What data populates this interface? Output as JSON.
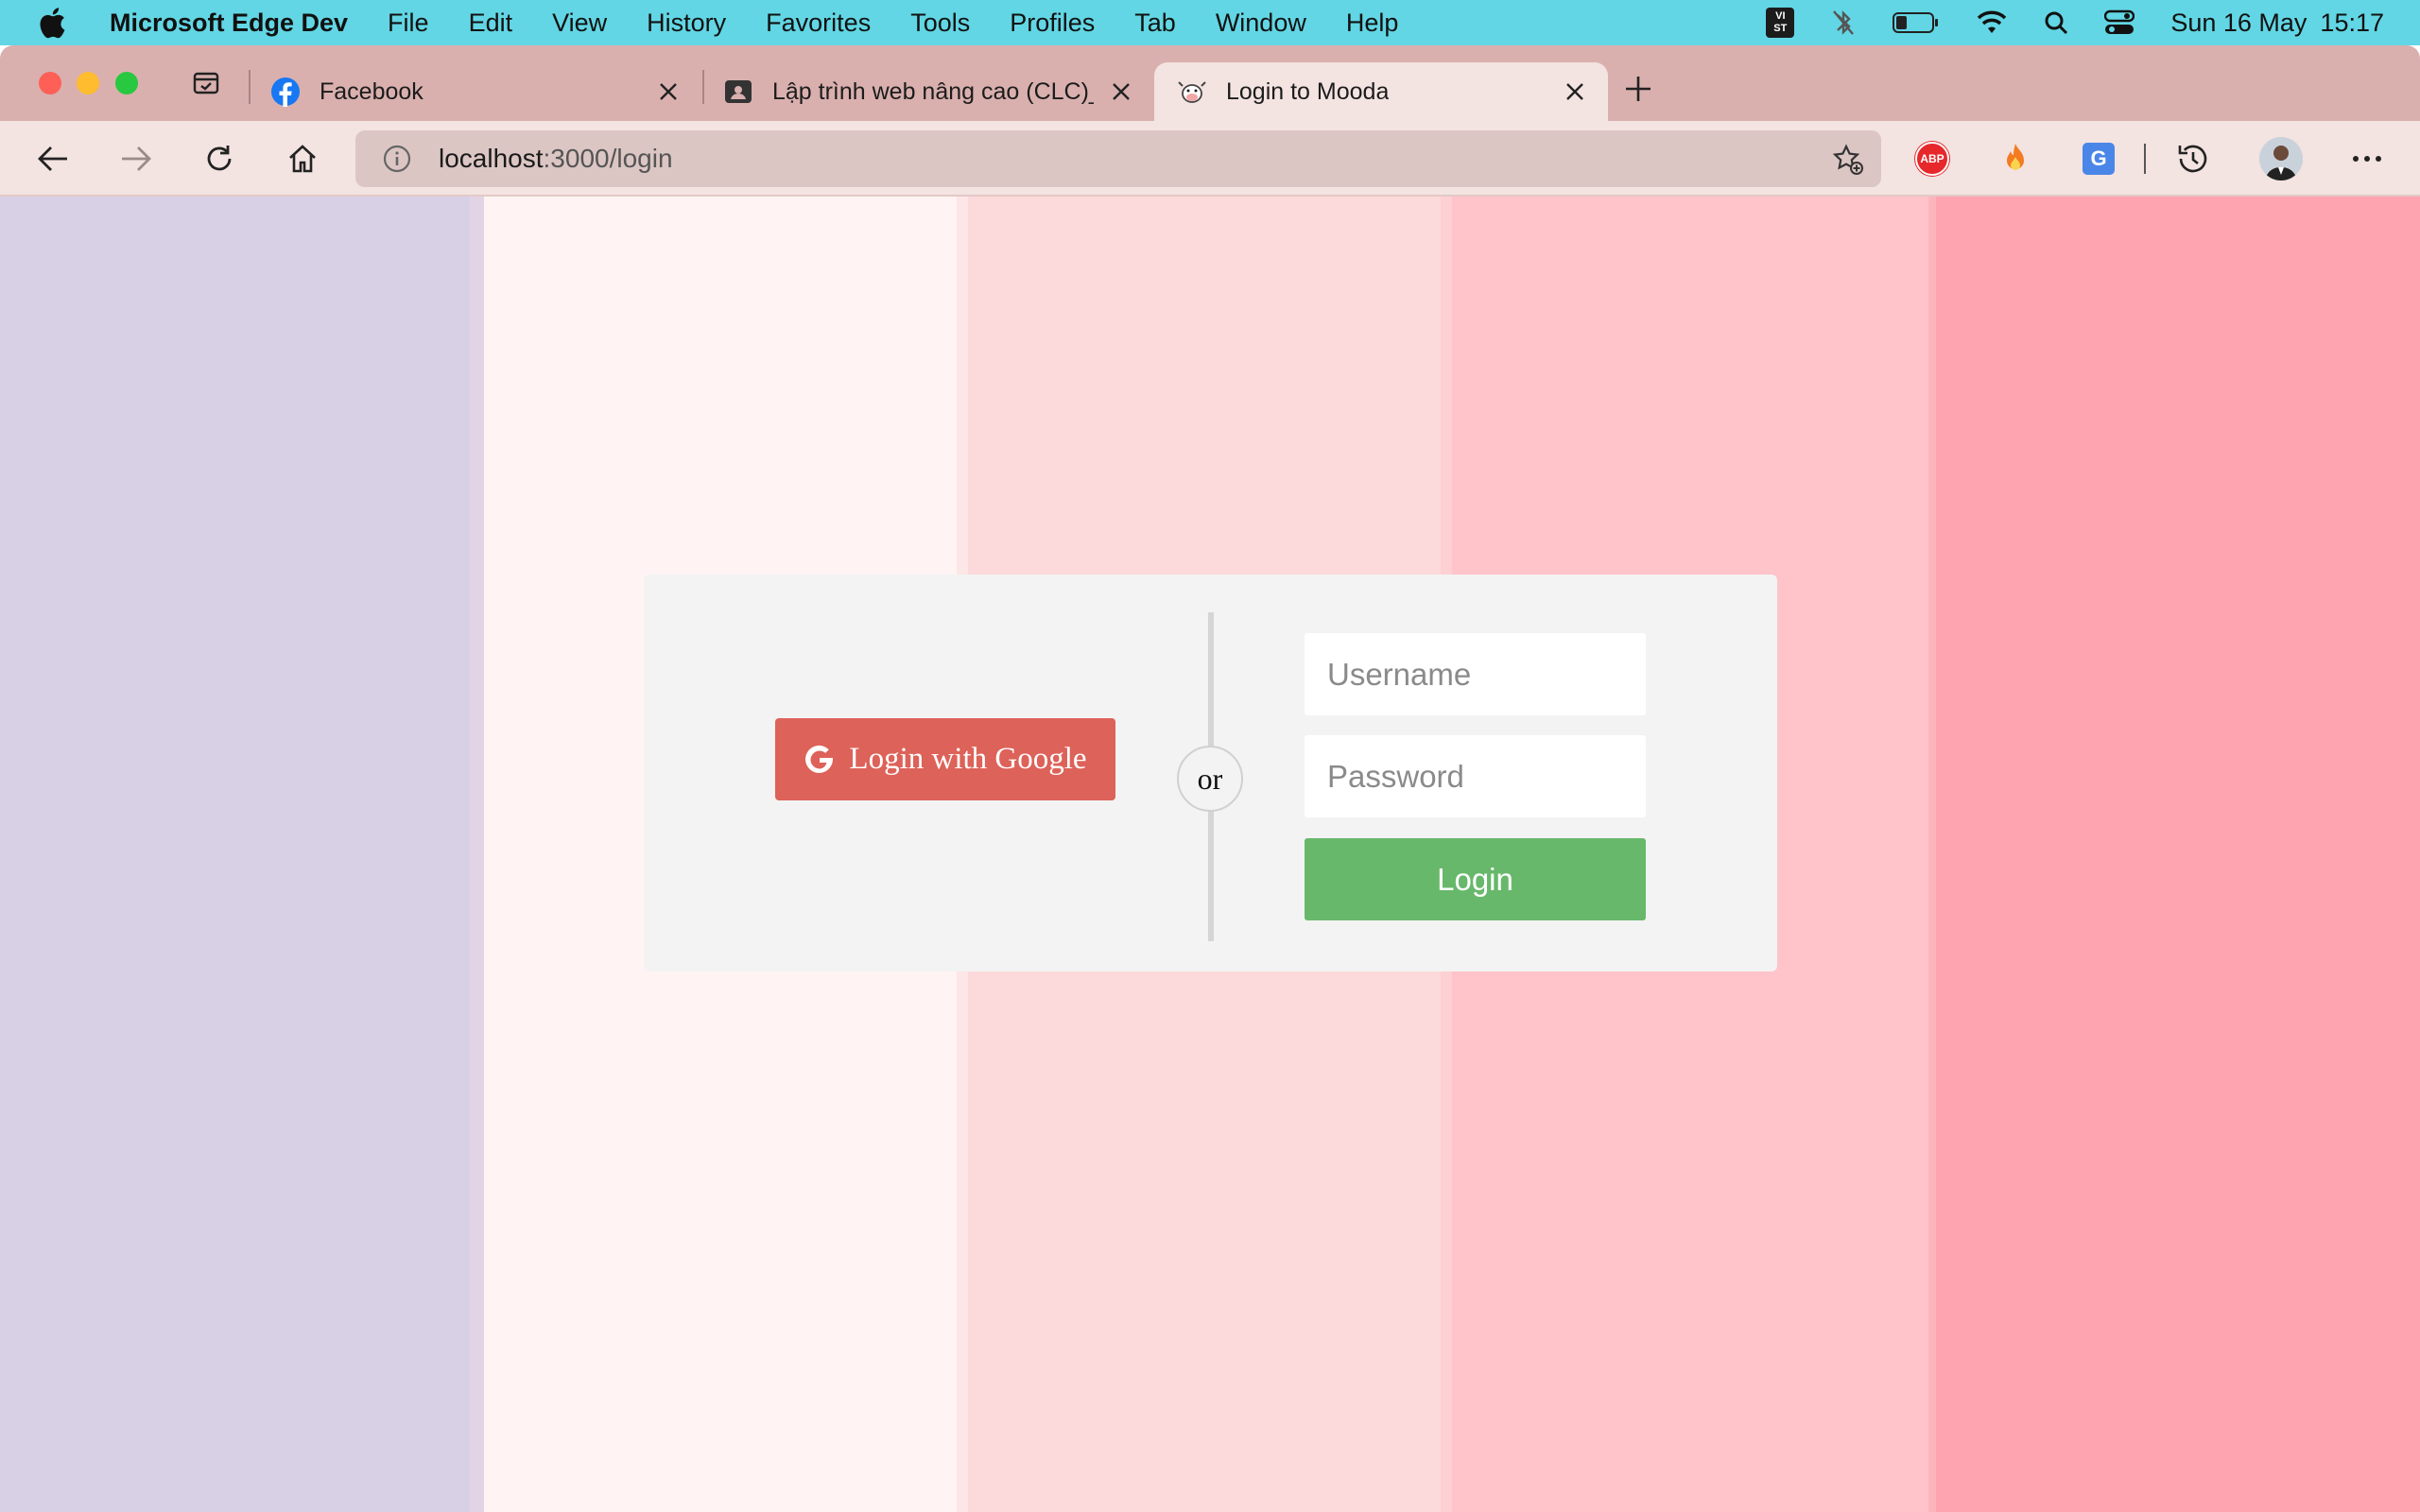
{
  "menubar": {
    "app_name": "Microsoft Edge Dev",
    "items": [
      "File",
      "Edit",
      "View",
      "History",
      "Favorites",
      "Tools",
      "Profiles",
      "Tab",
      "Window",
      "Help"
    ],
    "input_source_badge": "VI\nST",
    "date": "Sun 16 May",
    "time": "15:17"
  },
  "tabs": [
    {
      "title": "Facebook",
      "icon": "facebook-icon",
      "active": false
    },
    {
      "title": "Lập trình web nâng cao (CLC)_",
      "icon": "classroom-icon",
      "active": false
    },
    {
      "title": "Login to Mooda",
      "icon": "cow-icon",
      "active": true
    }
  ],
  "toolbar": {
    "url_host": "localhost",
    "url_rest": ":3000/login",
    "extensions": {
      "abp_label": "ABP",
      "translate_label": "G"
    }
  },
  "login": {
    "google_button": "Login with Google",
    "or_label": "or",
    "username_placeholder": "Username",
    "password_placeholder": "Password",
    "login_button": "Login"
  },
  "colors": {
    "menubar": "#62d6e4",
    "tabstrip": "#d9b0ae",
    "active_tab": "#f3e3e1",
    "stripes": [
      "#d8d1e6",
      "#fff3f3",
      "#fcd9da",
      "#fec4c9",
      "#fea4b0"
    ],
    "google_button": "#dd6259",
    "login_button": "#68b86b",
    "card": "#f3f3f3"
  }
}
